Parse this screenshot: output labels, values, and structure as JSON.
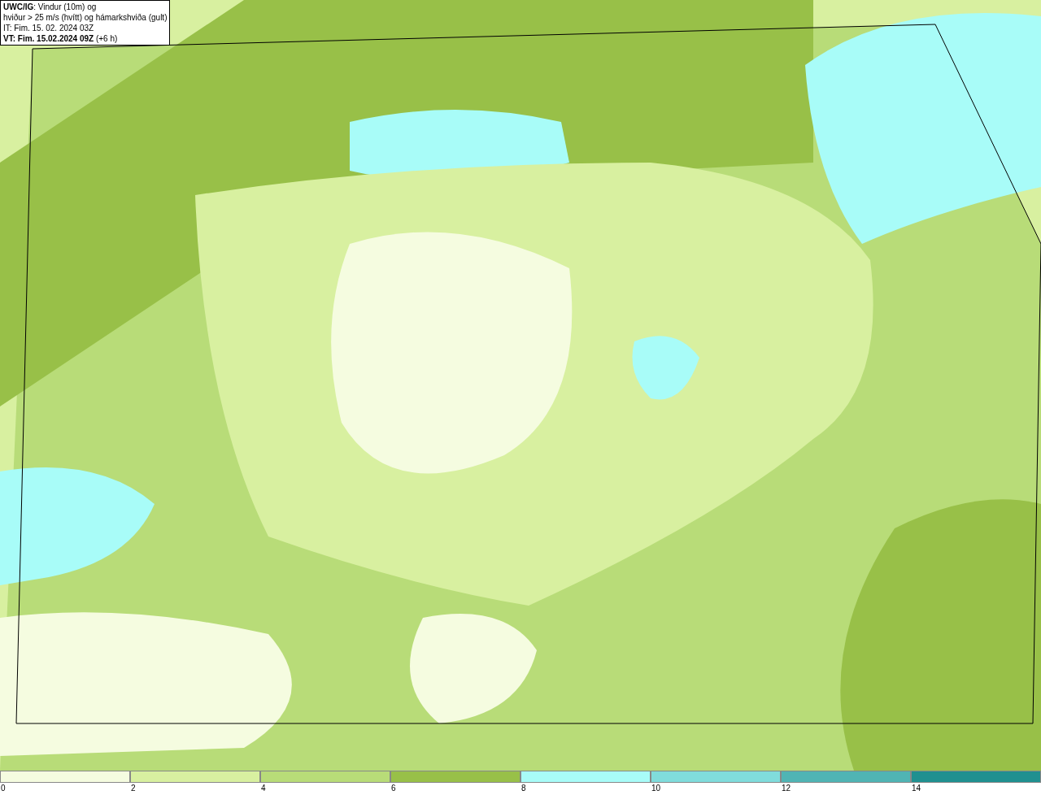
{
  "title_box": {
    "lines": [
      "**UWC/IG**: Vindur (10m) og",
      "hviður > 25 m/s (hvítt) og hámarkshviða (gult)",
      "IT: Fim. 15. 02. 2024 03Z",
      "**VT: Fim. 15.02.2024 09Z** (+6 h)"
    ]
  },
  "legend": [
    {
      "label": "0",
      "color": "#f5fce0"
    },
    {
      "label": "2",
      "color": "#d8f0a0"
    },
    {
      "label": "4",
      "color": "#b8dc78"
    },
    {
      "label": "6",
      "color": "#98c048"
    },
    {
      "label": "8",
      "color": "#a8fcf8"
    },
    {
      "label": "10",
      "color": "#80dcdc"
    },
    {
      "label": "12",
      "color": "#50b4b4"
    },
    {
      "label": "14",
      "color": "#209090"
    }
  ]
}
